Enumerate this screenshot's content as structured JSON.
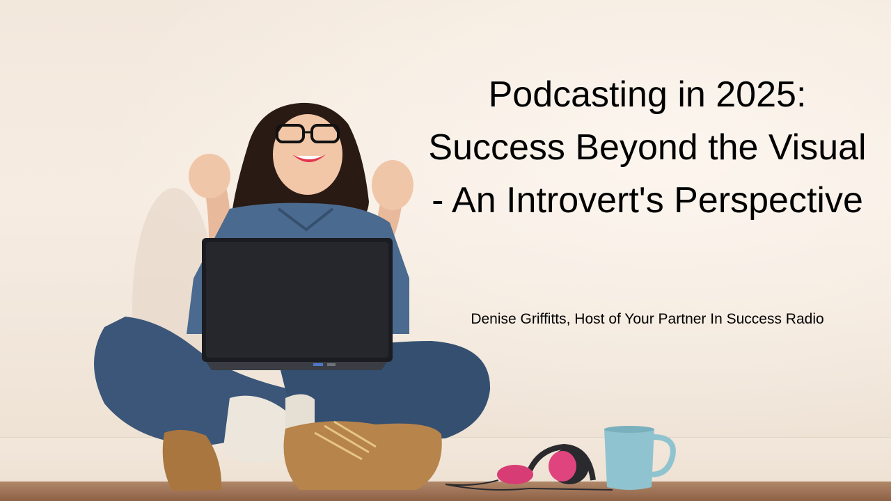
{
  "title": "Podcasting in 2025: Success Beyond the Visual - An Introvert's Perspective",
  "subtitle": "Denise Griffitts, Host of Your Partner In Success Radio",
  "colors": {
    "wall": "#f3e8dc",
    "text": "#000000",
    "jeans": "#3b5678",
    "laptop": "#1a1c21",
    "mug": "#8fc3cf",
    "headphones_accent": "#e0447f",
    "boots": "#b7844b",
    "floor": "#9a6d50"
  }
}
